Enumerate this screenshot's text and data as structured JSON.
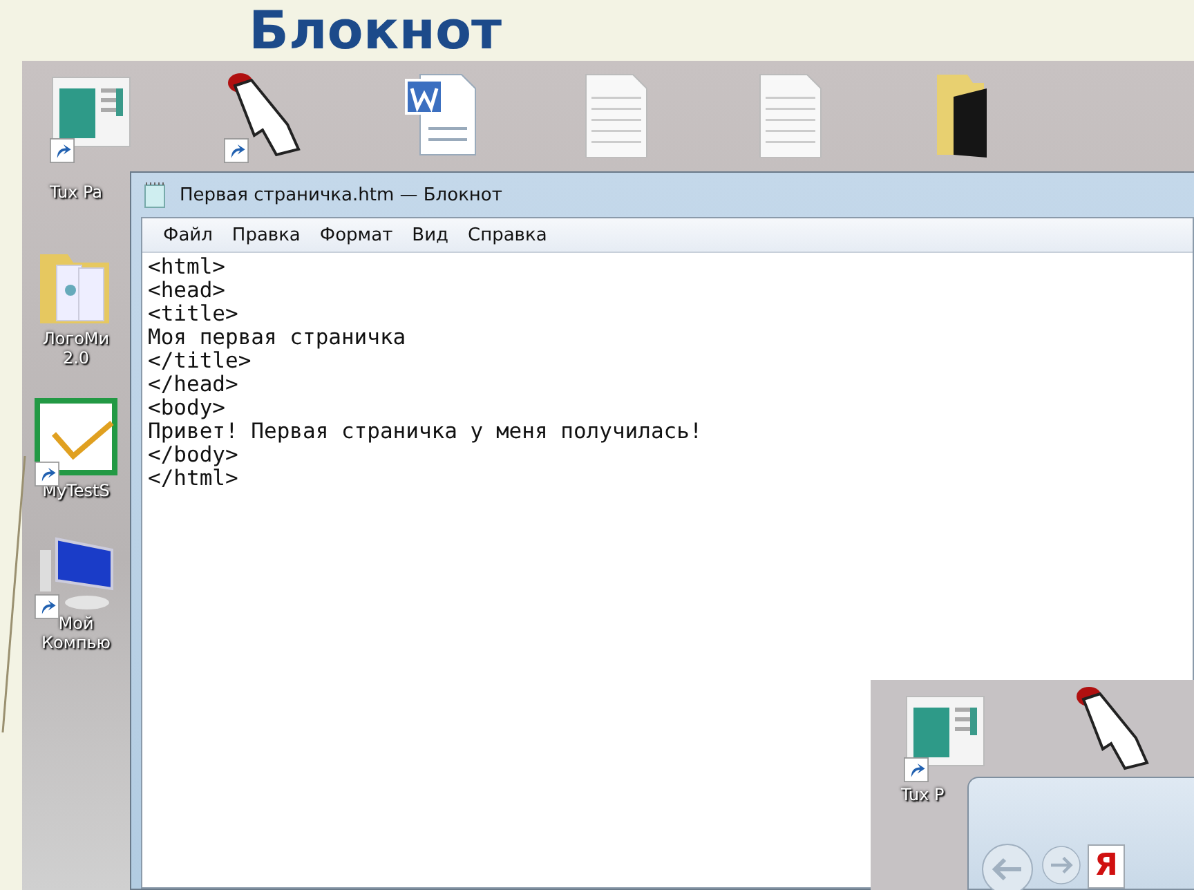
{
  "slide": {
    "title": "Блокнот"
  },
  "desktop": {
    "top_icons": [
      {
        "kind": "app",
        "shortcut": true
      },
      {
        "kind": "hand",
        "shortcut": true
      },
      {
        "kind": "word",
        "shortcut": false
      },
      {
        "kind": "text",
        "shortcut": false
      },
      {
        "kind": "text",
        "shortcut": false
      },
      {
        "kind": "folder-dark",
        "shortcut": false
      }
    ],
    "left_icons": [
      {
        "kind": "none",
        "labels": [
          "Tux Pa"
        ]
      },
      {
        "kind": "folder",
        "labels": [
          "ЛогоМи",
          "2.0"
        ]
      },
      {
        "kind": "test-shortcut",
        "labels": [
          "MyTestS"
        ]
      },
      {
        "kind": "computer-shortcut",
        "labels": [
          "Мой",
          "Компью"
        ]
      }
    ]
  },
  "notepad": {
    "title": "Первая страничка.htm — Блокнот",
    "menu": [
      "Файл",
      "Правка",
      "Формат",
      "Вид",
      "Справка"
    ],
    "lines": [
      "<html>",
      "<head>",
      "<title>",
      "Моя первая страничка",
      "</title>",
      "</head>",
      "<body>",
      "Привет! Первая страничка у меня получилась!",
      "</body>",
      "</html>"
    ]
  },
  "inset": {
    "label": "Tux P",
    "browser_logo": "Я"
  }
}
